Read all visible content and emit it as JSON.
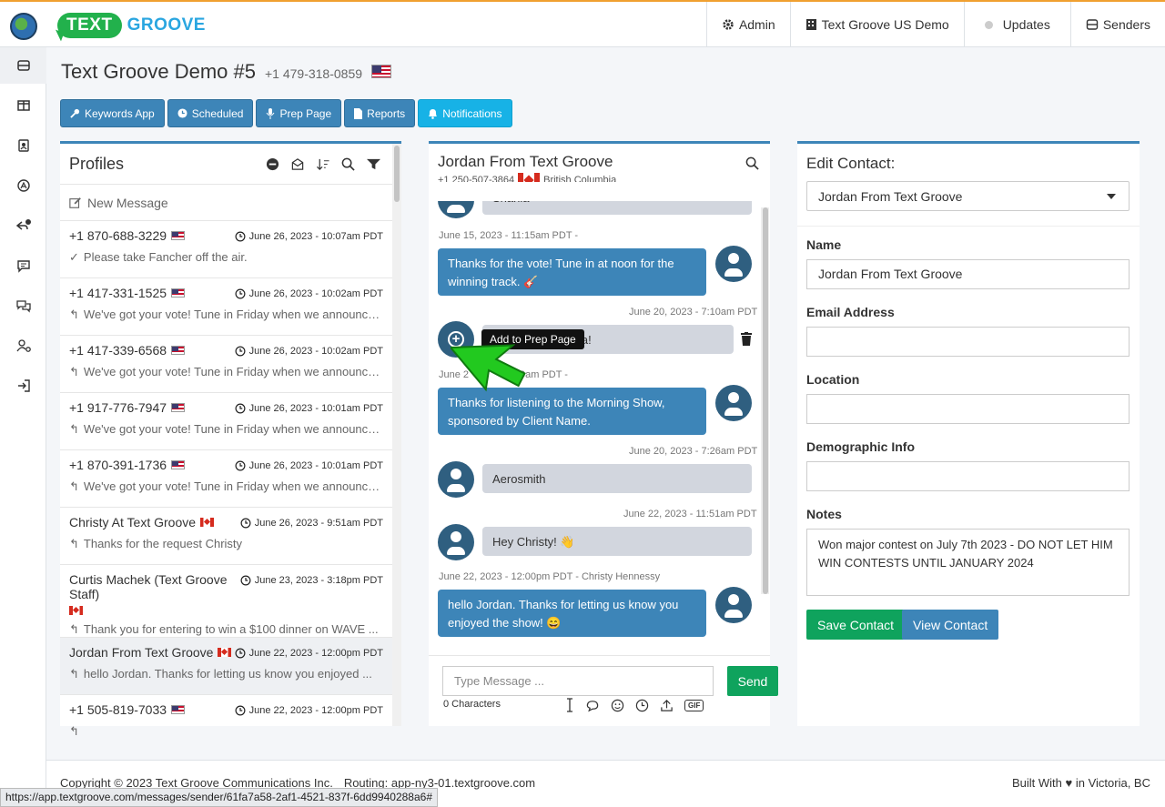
{
  "topnav": {
    "logo_left": "TEXT",
    "logo_right": "GROOVE",
    "admin": "Admin",
    "account": "Text Groove US Demo",
    "updates": "Updates",
    "senders": "Senders"
  },
  "page": {
    "title": "Text Groove Demo #5",
    "phone": "+1 479-318-0859"
  },
  "toolbar": {
    "keywords": "Keywords App",
    "scheduled": "Scheduled",
    "prep": "Prep Page",
    "reports": "Reports",
    "notifications": "Notifications"
  },
  "profiles": {
    "title": "Profiles",
    "new_message": "New Message",
    "rows": [
      {
        "name": "+1 870-688-3229",
        "flag": "us",
        "date": "June 26, 2023 - 10:07am PDT",
        "msg": "Please take Fancher off the air."
      },
      {
        "name": "+1 417-331-1525",
        "flag": "us",
        "date": "June 26, 2023 - 10:02am PDT",
        "msg": "We've got your vote! Tune in Friday when we announce..."
      },
      {
        "name": "+1 417-339-6568",
        "flag": "us",
        "date": "June 26, 2023 - 10:02am PDT",
        "msg": "We've got your vote! Tune in Friday when we announce..."
      },
      {
        "name": "+1 917-776-7947",
        "flag": "us",
        "date": "June 26, 2023 - 10:01am PDT",
        "msg": "We've got your vote! Tune in Friday when we announce..."
      },
      {
        "name": "+1 870-391-1736",
        "flag": "us",
        "date": "June 26, 2023 - 10:01am PDT",
        "msg": "We've got your vote! Tune in Friday when we announce..."
      },
      {
        "name": "Christy At Text Groove",
        "flag": "ca",
        "date": "June 26, 2023 - 9:51am PDT",
        "msg": "Thanks for the request Christy"
      },
      {
        "name": "Curtis Machek (Text Groove Staff)",
        "flag": "ca",
        "date": "June 23, 2023 - 3:18pm PDT",
        "msg": "Thank you for entering to win a $100 dinner on WAVE ..."
      },
      {
        "name": "Jordan From Text Groove",
        "flag": "ca",
        "date": "June 22, 2023 - 12:00pm PDT",
        "msg": "hello Jordan. Thanks for letting us know you enjoyed ..."
      },
      {
        "name": "+1 505-819-7033",
        "flag": "us",
        "date": "June 22, 2023 - 12:00pm PDT",
        "msg": ""
      }
    ]
  },
  "chat": {
    "name": "Jordan From Text Groove",
    "phone": "+1 250-507-3864",
    "region": "British Columbia",
    "top_partial": "Shania",
    "meta1": "June 15, 2023 - 11:15am PDT -",
    "out1": "Thanks for the vote! Tune in at noon for the winning track. 🎸",
    "meta2": "June 20, 2023 - 7:10am PDT",
    "in2_partial": "ia!",
    "tooltip": "Add to Prep Page",
    "meta3_left": "June 2",
    "meta3_right": "0am PDT -",
    "out3": "Thanks for listening to the Morning Show, sponsored by Client Name.",
    "meta4": "June 20, 2023 - 7:26am PDT",
    "in4": "Aerosmith",
    "meta5": "June 22, 2023 - 11:51am PDT",
    "in5": "Hey Christy! 👋",
    "meta6": "June 22, 2023 - 12:00pm PDT - Christy Hennessy",
    "out6": "hello Jordan. Thanks for letting us know you enjoyed the show! 😄",
    "placeholder": "Type Message ...",
    "send": "Send",
    "chars": "0 Characters",
    "gif": "GIF"
  },
  "edit": {
    "title": "Edit Contact:",
    "selected": "Jordan From Text Groove",
    "name_label": "Name",
    "name_value": "Jordan From Text Groove",
    "email_label": "Email Address",
    "location_label": "Location",
    "demo_label": "Demographic Info",
    "notes_label": "Notes",
    "notes_value": "Won major contest on July 7th 2023 - DO NOT LET HIM WIN CONTESTS UNTIL JANUARY 2024",
    "save": "Save Contact",
    "view": "View Contact"
  },
  "footer": {
    "copyright": "Copyright © 2023 Text Groove Communications Inc.",
    "routing": "Routing: app-ny3-01.textgroove.com",
    "built_pre": "Built With",
    "built_post": "in Victoria, BC"
  },
  "status_url": "https://app.textgroove.com/messages/sender/61fa7a58-2af1-4521-837f-6dd9940288a6#"
}
